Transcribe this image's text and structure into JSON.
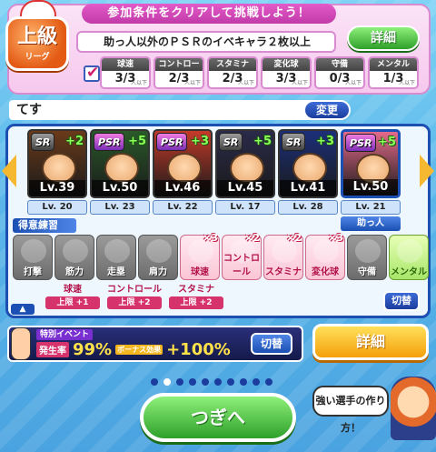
{
  "conditions": {
    "banner": "参加条件をクリアして挑戦しよう！",
    "rank": "上級",
    "rank_sub": "リーグ",
    "row1_text": "助っ人以外のＰＳＲのイベキャラ２枚以上",
    "detail_label": "詳細",
    "stats": [
      {
        "label": "球速",
        "value": "3/3",
        "note": "人以下"
      },
      {
        "label": "コントロール",
        "value": "2/3",
        "note": "人以下"
      },
      {
        "label": "スタミナ",
        "value": "2/3",
        "note": "人以下"
      },
      {
        "label": "変化球",
        "value": "3/3",
        "note": "人以下"
      },
      {
        "label": "守備",
        "value": "0/3",
        "note": "人以下"
      },
      {
        "label": "メンタル",
        "value": "1/3",
        "note": "人以下"
      }
    ]
  },
  "team": {
    "name": "てす",
    "change_label": "変更"
  },
  "deck": {
    "cards": [
      {
        "rarity": "SR",
        "plus": "+2",
        "lv": "Lv.39",
        "sub": "Lv. 20",
        "helper": false,
        "art_color": "#6a3a1a"
      },
      {
        "rarity": "PSR",
        "plus": "+5",
        "lv": "Lv.50",
        "sub": "Lv. 23",
        "helper": false,
        "art_color": "#2a5a2a"
      },
      {
        "rarity": "PSR",
        "plus": "+3",
        "lv": "Lv.46",
        "sub": "Lv. 22",
        "helper": false,
        "art_color": "#c43a2a"
      },
      {
        "rarity": "SR",
        "plus": "+5",
        "lv": "Lv.45",
        "sub": "Lv. 17",
        "helper": false,
        "art_color": "#2a2a4a"
      },
      {
        "rarity": "SR",
        "plus": "+3",
        "lv": "Lv.41",
        "sub": "Lv. 28",
        "helper": false,
        "art_color": "#1b2f7a"
      },
      {
        "rarity": "PSR",
        "plus": "+5",
        "lv": "Lv.50",
        "sub": "Lv. 21",
        "helper": true,
        "art_color": "#e36a8a"
      }
    ],
    "helper_label": "助っ人",
    "practice_title": "得意練習",
    "practices": [
      {
        "label": "打撃",
        "on": false,
        "mult": ""
      },
      {
        "label": "筋力",
        "on": false,
        "mult": ""
      },
      {
        "label": "走塁",
        "on": false,
        "mult": ""
      },
      {
        "label": "肩力",
        "on": false,
        "mult": ""
      },
      {
        "label": "球速",
        "on": true,
        "mult": "×3"
      },
      {
        "label": "コントロール",
        "on": true,
        "mult": "×2"
      },
      {
        "label": "スタミナ",
        "on": true,
        "mult": "×2"
      },
      {
        "label": "変化球",
        "on": true,
        "mult": "×3"
      },
      {
        "label": "守備",
        "on": false,
        "mult": ""
      },
      {
        "label": "メンタル",
        "on": true,
        "mult": "",
        "green": true
      }
    ],
    "limits": [
      {
        "name": "球速",
        "value": "上限 +1"
      },
      {
        "name": "コントロール",
        "value": "上限 +2"
      },
      {
        "name": "スタミナ",
        "value": "上限 +2"
      }
    ],
    "switch_label": "切替"
  },
  "event": {
    "tag": "特別イベント",
    "rate_label": "発生率",
    "rate_value": "99%",
    "bonus_label": "ボーナス効果",
    "bonus_value": "+100%",
    "switch_label": "切替"
  },
  "detail_big_label": "詳細",
  "pagination": {
    "count": 10,
    "active": 1
  },
  "next_label": "つぎへ",
  "tip_text": "強い選手の作り方！"
}
